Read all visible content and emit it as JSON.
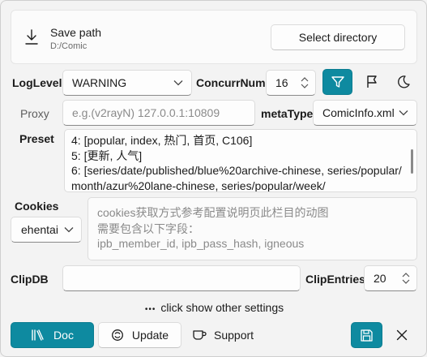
{
  "save_path": {
    "title": "Save path",
    "path": "D:/Comic",
    "select_button": "Select directory"
  },
  "log_level": {
    "label": "LogLevel",
    "value": "WARNING"
  },
  "concurrency": {
    "label": "ConcurrNum",
    "value": "16"
  },
  "toolbar": {
    "filter_icon": "filter-icon",
    "flag_icon": "flag-icon",
    "theme_icon": "moon-icon",
    "accent_color": "#0e8aa0"
  },
  "proxy": {
    "label": "Proxy",
    "placeholder": "e.g.(v2rayN) 127.0.0.1:10809"
  },
  "meta_type": {
    "label": "metaType",
    "value": "ComicInfo.xml"
  },
  "preset": {
    "label": "Preset",
    "lines": [
      "4: [popular, index, 热门, 首页, C106]",
      "5: [更新, 人气]",
      "6: [series/date/published/blue%20archive-chinese, series/popular/",
      "month/azur%20lane-chinese, series/popular/week/"
    ]
  },
  "cookies": {
    "label": "Cookies",
    "site": "ehentai",
    "hint_lines": [
      "cookies获取方式参考配置说明页此栏目的动图",
      "需要包含以下字段：",
      "ipb_member_id, ipb_pass_hash, igneous"
    ]
  },
  "clip": {
    "db_label": "ClipDB",
    "entries_label": "ClipEntries",
    "entries_value": "20"
  },
  "more_settings": {
    "dots": "•••",
    "text": "click show other settings"
  },
  "footer": {
    "doc_label": "Doc",
    "update_label": "Update",
    "support_label": "Support"
  }
}
